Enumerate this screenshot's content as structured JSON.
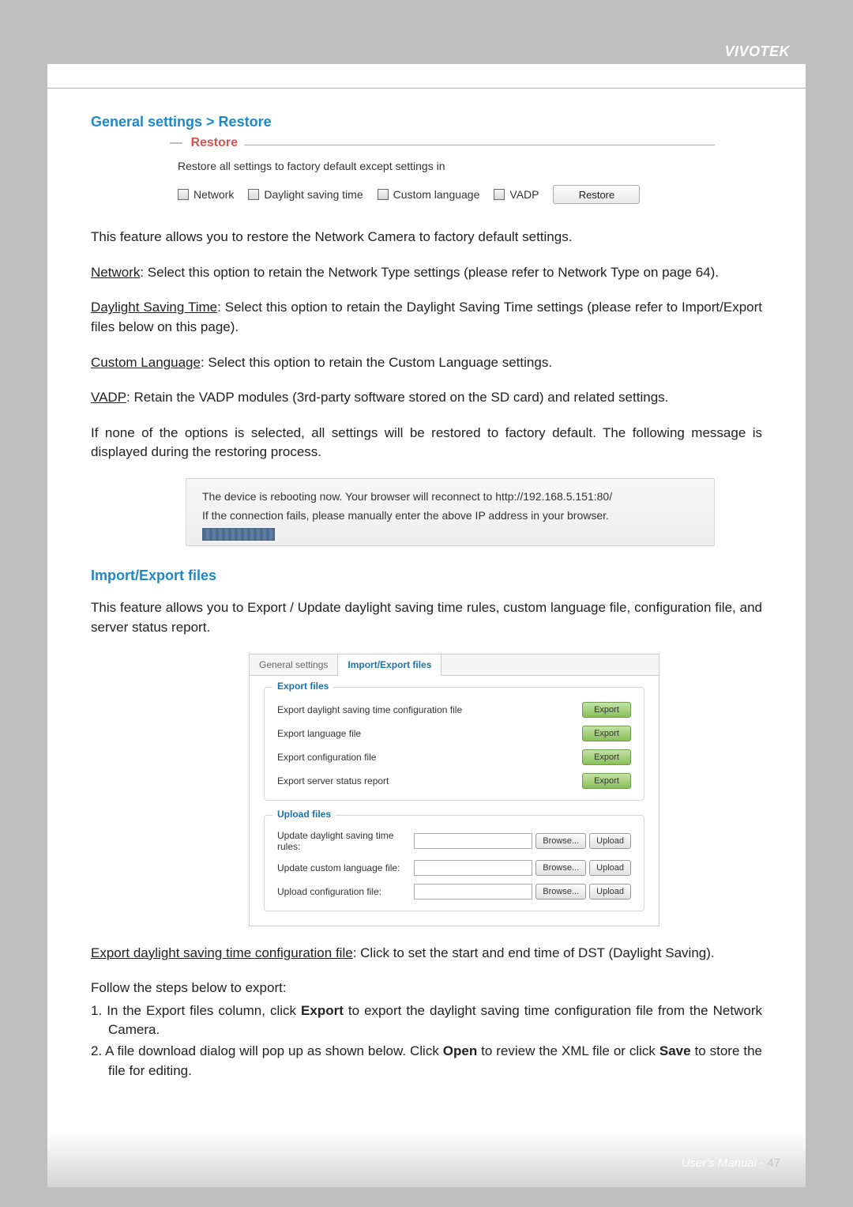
{
  "header": {
    "brand": "VIVOTEK"
  },
  "section1": {
    "title": "General settings > Restore",
    "fieldset": {
      "legend": "Restore",
      "desc": "Restore all settings to factory default except settings in",
      "checks": [
        "Network",
        "Daylight saving time",
        "Custom language",
        "VADP"
      ],
      "button": "Restore"
    },
    "intro": "This feature allows you to restore the Network Camera to factory default settings.",
    "opt_network_label": "Network",
    "opt_network_text": ": Select this option to retain the Network Type settings (please refer to Network Type on page 64).",
    "opt_dst_label": "Daylight Saving Time",
    "opt_dst_text": ": Select this option to retain the Daylight Saving Time settings (please refer to Import/Export files below on this page).",
    "opt_lang_label": "Custom Language",
    "opt_lang_text": ": Select this option to retain the Custom Language settings.",
    "opt_vadp_label": "VADP",
    "opt_vadp_text": ": Retain the VADP modules (3rd-party software stored on the SD card) and related settings.",
    "fallback": "If none of the options is selected, all settings will be restored to factory default.  The following message is displayed during the restoring process.",
    "reboot1": "The device is rebooting now. Your browser will reconnect to http://192.168.5.151:80/",
    "reboot2": "If the connection fails, please manually enter the above IP address in your browser."
  },
  "section2": {
    "title": "Import/Export files",
    "intro": "This feature allows you to Export / Update daylight saving time rules, custom language file, configuration file, and server status report.",
    "tabs": {
      "general": "General settings",
      "ie": "Import/Export files"
    },
    "export_legend": "Export files",
    "export_rows": [
      "Export daylight saving time configuration file",
      "Export language file",
      "Export configuration file",
      "Export server status report"
    ],
    "export_btn": "Export",
    "upload_legend": "Upload files",
    "upload_rows": [
      "Update daylight saving time rules:",
      "Update custom language file:",
      "Upload configuration file:"
    ],
    "browse_btn": "Browse...",
    "upload_btn": "Upload",
    "export_dst_label": "Export daylight saving time configuration file",
    "export_dst_text": ": Click to set the start and end time of DST (Daylight Saving).",
    "steps_intro": "Follow the steps below to export:",
    "step1_a": "1. In the Export files column, click ",
    "step1_b": "Export",
    "step1_c": " to export the daylight saving time configuration file from the Network Camera.",
    "step2_a": "2. A file download dialog will pop up as shown below. Click ",
    "step2_b": "Open",
    "step2_c": " to review the XML file or click ",
    "step2_d": "Save",
    "step2_e": " to store the file for editing."
  },
  "footer": {
    "manual": "User's Manual - ",
    "page": "47"
  }
}
